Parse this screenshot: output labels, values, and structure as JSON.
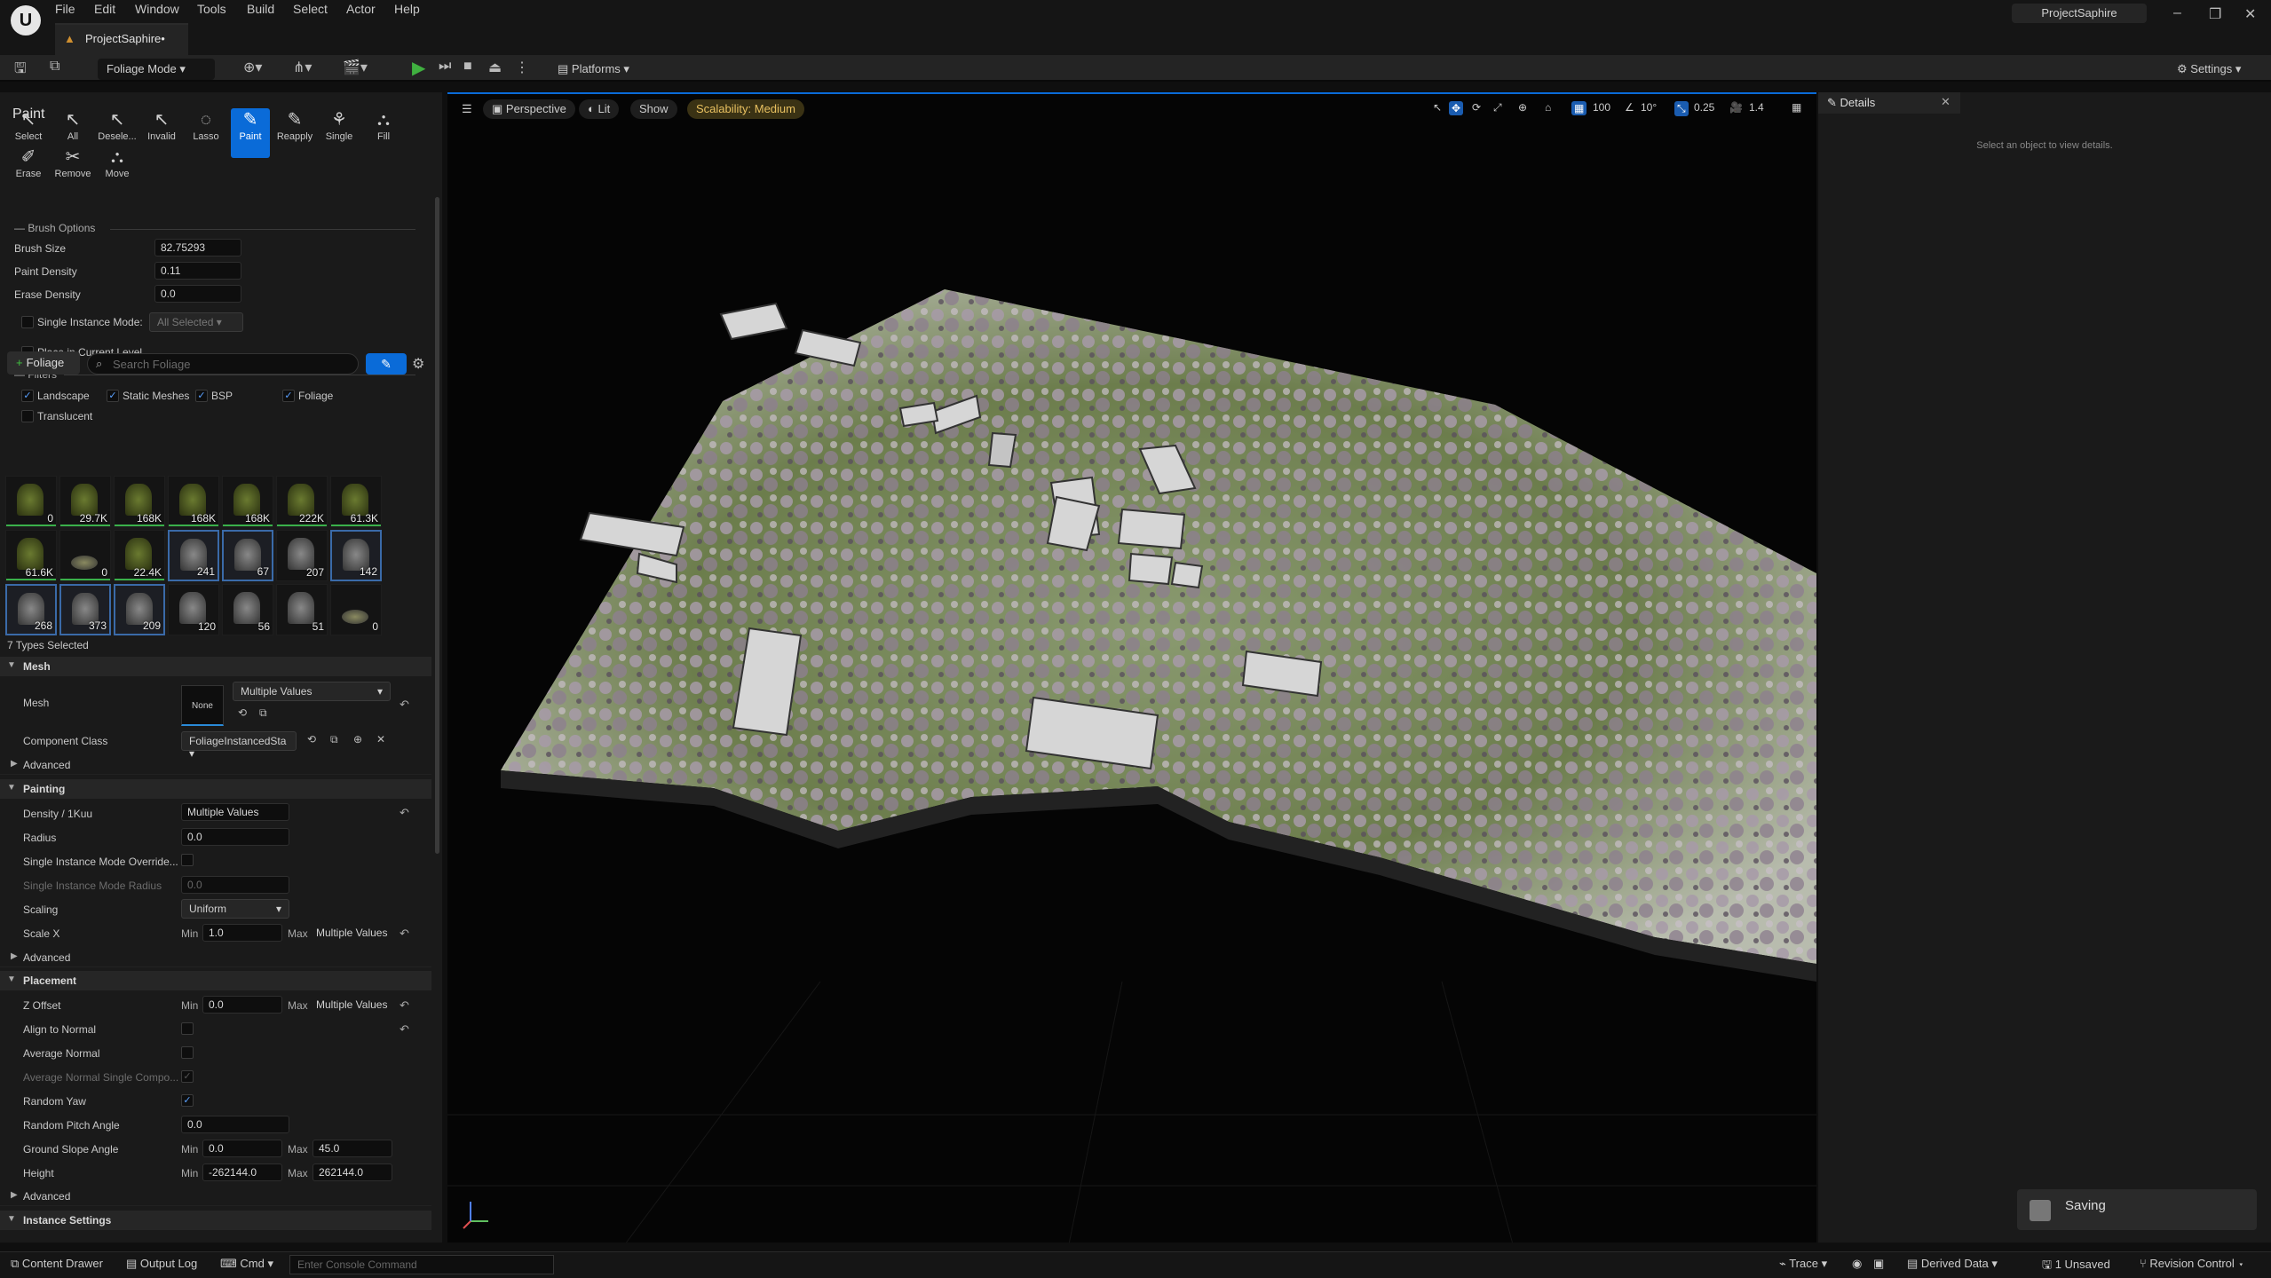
{
  "menu": [
    "File",
    "Edit",
    "Window",
    "Tools",
    "Build",
    "Select",
    "Actor",
    "Help"
  ],
  "project_tab": "ProjectSaphire•",
  "app_title": "ProjectSaphire",
  "toolbar": {
    "mode": "Foliage Mode",
    "platforms": "Platforms",
    "settings": "Settings"
  },
  "tools_row1": [
    {
      "name": "select",
      "label": "Select",
      "glyph": "↖"
    },
    {
      "name": "all",
      "label": "All",
      "glyph": "↖"
    },
    {
      "name": "deselect",
      "label": "Desele...",
      "glyph": "↖"
    },
    {
      "name": "invalid",
      "label": "Invalid",
      "glyph": "↖"
    },
    {
      "name": "lasso",
      "label": "Lasso",
      "glyph": "◌"
    },
    {
      "name": "paint",
      "label": "Paint",
      "glyph": "✎",
      "active": true
    },
    {
      "name": "reapply",
      "label": "Reapply",
      "glyph": "✎"
    },
    {
      "name": "single",
      "label": "Single",
      "glyph": "⚘"
    },
    {
      "name": "fill",
      "label": "Fill",
      "glyph": "⛬"
    }
  ],
  "tools_row2": [
    {
      "name": "erase",
      "label": "Erase",
      "glyph": "✐"
    },
    {
      "name": "remove",
      "label": "Remove",
      "glyph": "✂"
    },
    {
      "name": "move",
      "label": "Move",
      "glyph": "⛬"
    }
  ],
  "paint": {
    "header": "Paint",
    "brush_options": "Brush Options",
    "brush_size_label": "Brush Size",
    "brush_size": "82.75293",
    "paint_density_label": "Paint Density",
    "paint_density": "0.11",
    "erase_density_label": "Erase Density",
    "erase_density": "0.0",
    "single_instance_label": "Single Instance Mode:",
    "single_instance_value": "All Selected",
    "place_current_level": "Place in Current Level",
    "filters": "Filters",
    "filter_landscape": "Landscape",
    "filter_static": "Static Meshes",
    "filter_bsp": "BSP",
    "filter_foliage": "Foliage",
    "filter_translucent": "Translucent"
  },
  "foliage_bar": {
    "add_label": "Foliage",
    "search_placeholder": "Search Foliage"
  },
  "tiles": [
    {
      "count": "0",
      "sel": false,
      "kind": "green"
    },
    {
      "count": "29.7K",
      "sel": false,
      "kind": "green"
    },
    {
      "count": "168K",
      "sel": false,
      "kind": "green"
    },
    {
      "count": "168K",
      "sel": false,
      "kind": "green"
    },
    {
      "count": "168K",
      "sel": false,
      "kind": "green"
    },
    {
      "count": "222K",
      "sel": false,
      "kind": "green"
    },
    {
      "count": "61.3K",
      "sel": false,
      "kind": "green"
    },
    {
      "count": "61.6K",
      "sel": false,
      "kind": "green"
    },
    {
      "count": "0",
      "sel": false,
      "kind": "flat"
    },
    {
      "count": "22.4K",
      "sel": false,
      "kind": "green"
    },
    {
      "count": "241",
      "sel": true,
      "kind": "tree"
    },
    {
      "count": "67",
      "sel": true,
      "kind": "tree"
    },
    {
      "count": "207",
      "sel": false,
      "kind": "tree"
    },
    {
      "count": "142",
      "sel": true,
      "kind": "tree"
    },
    {
      "count": "268",
      "sel": true,
      "kind": "tree"
    },
    {
      "count": "373",
      "sel": true,
      "kind": "tree"
    },
    {
      "count": "209",
      "sel": true,
      "kind": "tree"
    },
    {
      "count": "120",
      "sel": false,
      "kind": "tree"
    },
    {
      "count": "56",
      "sel": false,
      "kind": "tree"
    },
    {
      "count": "51",
      "sel": false,
      "kind": "tree"
    },
    {
      "count": "0",
      "sel": false,
      "kind": "flat"
    }
  ],
  "types_selected": "7 Types Selected",
  "mesh": {
    "section": "Mesh",
    "mesh_label": "Mesh",
    "none": "None",
    "mesh_value": "Multiple Values",
    "component_class_label": "Component Class",
    "component_class": "FoliageInstancedSta"
  },
  "advanced": "Advanced",
  "painting": {
    "section": "Painting",
    "density_label": "Density / 1Kuu",
    "density": "Multiple Values",
    "radius_label": "Radius",
    "radius": "0.0",
    "sim_override_label": "Single Instance Mode Override...",
    "sim_radius_label": "Single Instance Mode Radius",
    "sim_radius": "0.0",
    "scaling_label": "Scaling",
    "scaling": "Uniform",
    "scalex_label": "Scale X",
    "min": "Min",
    "max": "Max",
    "scalex_min": "1.0",
    "scalex_max": "Multiple Values"
  },
  "placement": {
    "section": "Placement",
    "zoffset_label": "Z Offset",
    "zoffset_min": "0.0",
    "zoffset_max": "Multiple Values",
    "align_label": "Align to Normal",
    "avg_normal_label": "Average Normal",
    "avg_normal_single_label": "Average Normal Single Compo...",
    "random_yaw_label": "Random Yaw",
    "pitch_label": "Random Pitch Angle",
    "pitch": "0.0",
    "slope_label": "Ground Slope Angle",
    "slope_min": "0.0",
    "slope_max": "45.0",
    "height_label": "Height",
    "height_min": "-262144.0",
    "height_max": "262144.0"
  },
  "instance_settings": "Instance Settings",
  "viewport": {
    "perspective": "Perspective",
    "lit": "Lit",
    "show": "Show",
    "scalability": "Scalability: Medium",
    "grid": "100",
    "angle": "10°",
    "scale": "0.25",
    "camera": "1.4"
  },
  "details": {
    "tab": "Details",
    "hint": "Select an object to view details.",
    "saving": "Saving"
  },
  "status": {
    "content_drawer": "Content Drawer",
    "output_log": "Output Log",
    "cmd": "Cmd",
    "console_placeholder": "Enter Console Command",
    "trace": "Trace",
    "derived_data": "Derived Data",
    "unsaved": "1 Unsaved",
    "revision": "Revision Control"
  }
}
